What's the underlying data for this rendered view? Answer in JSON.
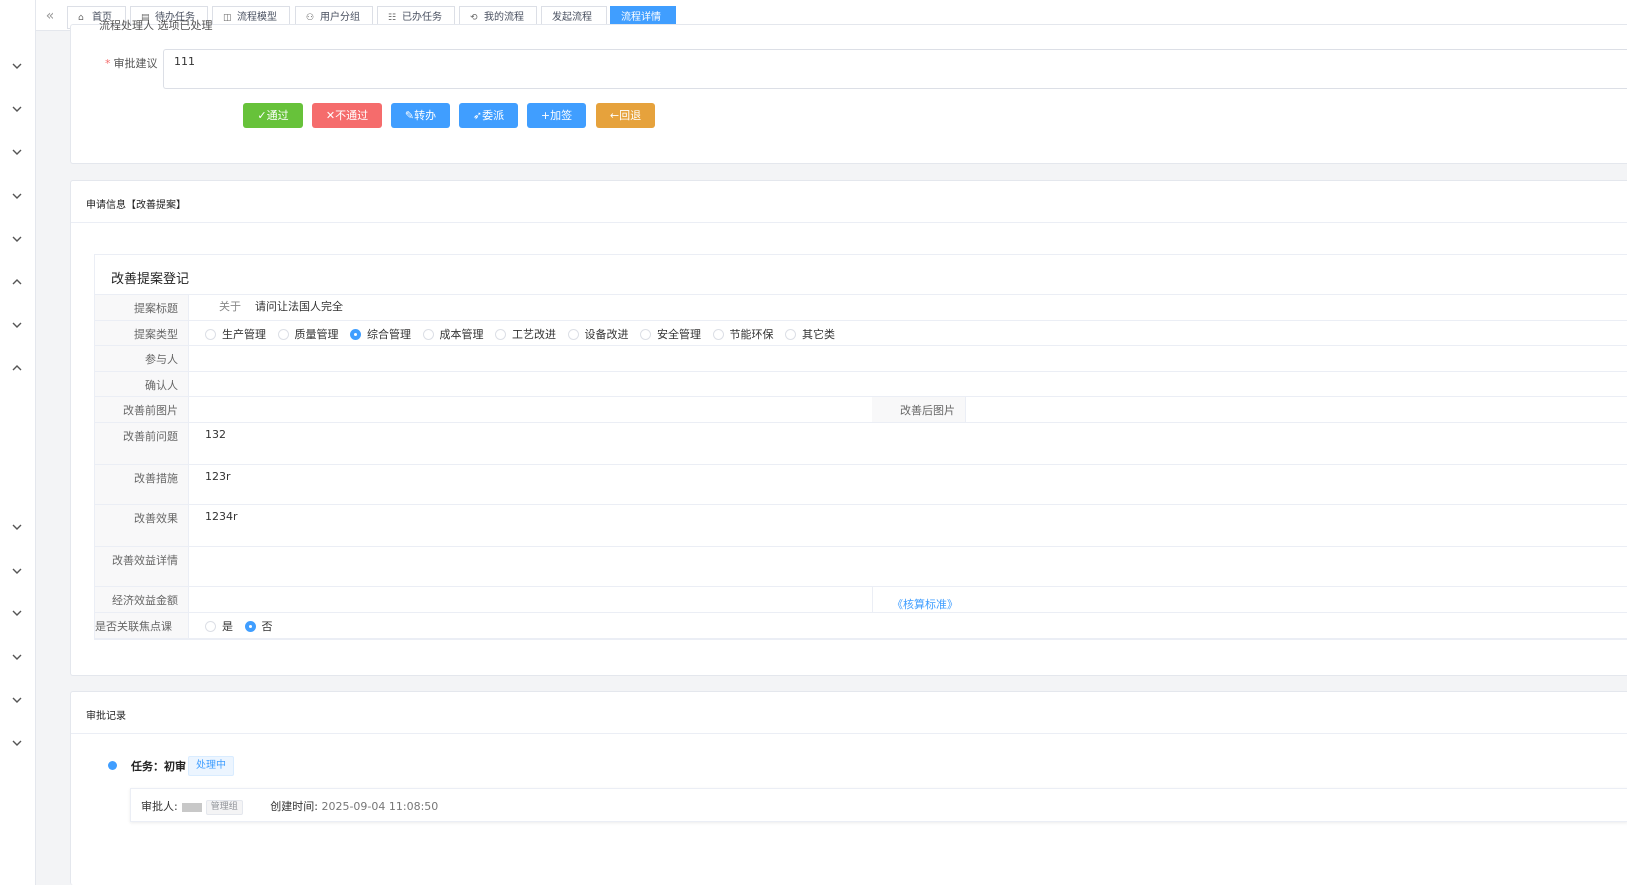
{
  "tabs": [
    {
      "label": "首页",
      "icon": "home-icon",
      "glyph": "⌂"
    },
    {
      "label": "待办任务",
      "icon": "todo-icon",
      "glyph": "▤"
    },
    {
      "label": "流程模型",
      "icon": "model-icon",
      "glyph": "◫"
    },
    {
      "label": "用户分组",
      "icon": "users-icon",
      "glyph": "⚇"
    },
    {
      "label": "已办任务",
      "icon": "done-icon",
      "glyph": "☷"
    },
    {
      "label": "我的流程",
      "icon": "flow-icon",
      "glyph": "⟲"
    },
    {
      "label": "发起流程",
      "icon": "",
      "glyph": ""
    },
    {
      "label": "流程详情",
      "icon": "",
      "glyph": ""
    }
  ],
  "active_tab": "流程详情",
  "opinion": {
    "clipped_text": "流程处理人    选项已处理",
    "label": "审批建议",
    "value": "111"
  },
  "actions": {
    "pass": "✓通过",
    "fail": "✕不通过",
    "transfer": "✎转办",
    "assign": "➶委派",
    "add_sign": "+加签",
    "rollback": "←回退"
  },
  "apply": {
    "header": "申请信息【改善提案】",
    "form_title": "改善提案登记",
    "rows": {
      "title_label": "提案标题",
      "title_prefix": "关于",
      "title_value": "请问让法国人完全",
      "type_label": "提案类型",
      "participant_label": "参与人",
      "confirmer_label": "确认人",
      "before_pic_label": "改善前图片",
      "after_pic_label": "改善后图片",
      "before_problem_label": "改善前问题",
      "before_problem_value": "132",
      "measure_label": "改善措施",
      "measure_value": "123r",
      "effect_label": "改善效果",
      "effect_value": "1234r",
      "benefit_detail_label": "改善效益详情",
      "benefit_amount_label": "经济效益金额",
      "calc_link": "《核算标准》",
      "focus_label": "是否关联焦点课",
      "yes": "是",
      "no": "否"
    },
    "types": [
      {
        "label": "生产管理",
        "checked": false
      },
      {
        "label": "质量管理",
        "checked": false
      },
      {
        "label": "综合管理",
        "checked": true
      },
      {
        "label": "成本管理",
        "checked": false
      },
      {
        "label": "工艺改进",
        "checked": false
      },
      {
        "label": "设备改进",
        "checked": false
      },
      {
        "label": "安全管理",
        "checked": false
      },
      {
        "label": "节能环保",
        "checked": false
      },
      {
        "label": "其它类",
        "checked": false
      }
    ]
  },
  "record": {
    "header": "审批记录",
    "task_label": "任务：初审",
    "status": "处理中",
    "approver_label": "审批人:",
    "approver_tag": "管理组",
    "created_label": "创建时间:",
    "created_value": "2025-09-04 11:08:50"
  },
  "colors": {
    "primary": "#409eff",
    "success": "#67c23a",
    "danger": "#f56c6c",
    "warning": "#e6a23c"
  }
}
